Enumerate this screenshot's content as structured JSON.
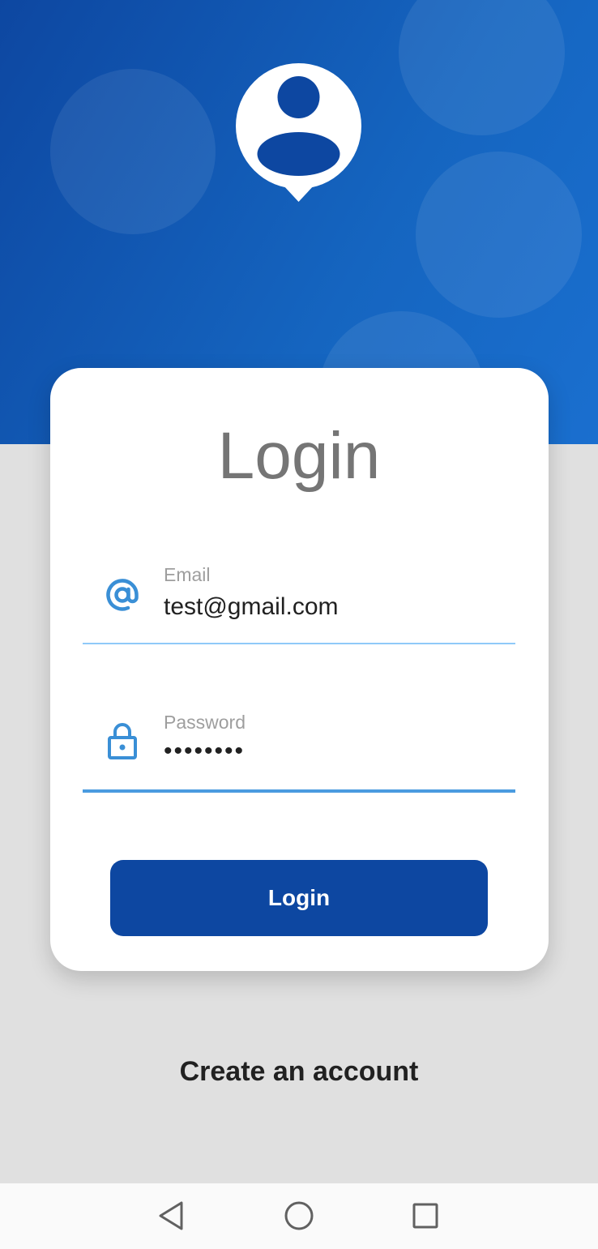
{
  "header": {
    "background_color": "#0d47a1",
    "logo_icon": "user-location-pin-icon"
  },
  "card": {
    "title": "Login",
    "email": {
      "icon": "at-sign-icon",
      "label": "Email",
      "value": "test@gmail.com"
    },
    "password": {
      "icon": "lock-icon",
      "label": "Password",
      "value": "••••••••"
    },
    "login_button_label": "Login"
  },
  "create_account_label": "Create an account",
  "navbar": {
    "back_icon": "back-triangle-icon",
    "home_icon": "home-circle-icon",
    "recent_icon": "recent-apps-square-icon"
  },
  "colors": {
    "accent": "#0d47a1",
    "icon_blue": "#3a8fd6",
    "background": "#e0e0e0"
  }
}
